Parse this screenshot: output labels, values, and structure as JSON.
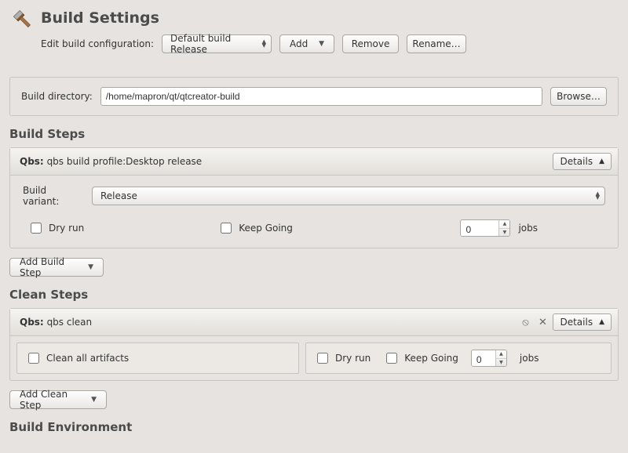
{
  "header": {
    "title": "Build Settings",
    "config_label": "Edit build configuration:",
    "config_value": "Default build Release",
    "add_label": "Add",
    "remove_label": "Remove",
    "rename_label": "Rename…"
  },
  "build_dir": {
    "label": "Build directory:",
    "value": "/home/mapron/qt/qtcreator-build",
    "browse_label": "Browse…"
  },
  "build_steps": {
    "heading": "Build Steps",
    "step_prefix": "Qbs:",
    "step_title": "qbs build profile:Desktop release",
    "details_label": "Details",
    "variant_label": "Build variant:",
    "variant_value": "Release",
    "dry_run_label": "Dry run",
    "keep_going_label": "Keep Going",
    "jobs_value": "0",
    "jobs_label": "jobs",
    "add_step_label": "Add Build Step"
  },
  "clean_steps": {
    "heading": "Clean Steps",
    "step_prefix": "Qbs:",
    "step_title": "qbs clean",
    "details_label": "Details",
    "clean_all_label": "Clean all artifacts",
    "dry_run_label": "Dry run",
    "keep_going_label": "Keep Going",
    "jobs_value": "0",
    "jobs_label": "jobs",
    "add_step_label": "Add Clean Step"
  },
  "build_env": {
    "heading": "Build Environment"
  }
}
